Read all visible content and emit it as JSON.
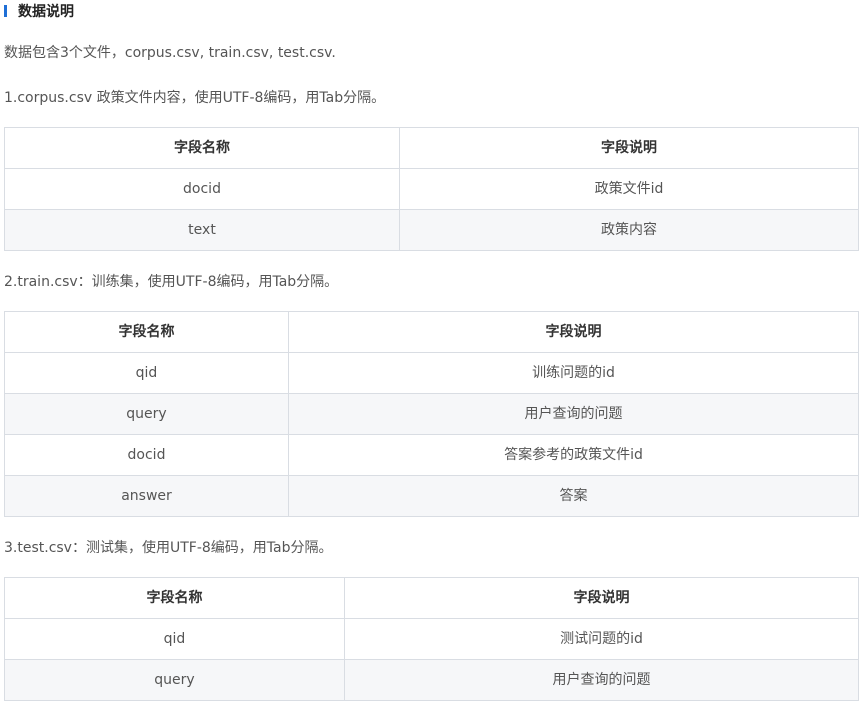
{
  "heading": "数据说明",
  "intro": "数据包含3个文件，corpus.csv, train.csv, test.csv.",
  "accent_color": "#1f6fd6",
  "sections": [
    {
      "desc": "1.corpus.csv 政策文件内容，使用UTF-8编码，用Tab分隔。",
      "headers": [
        "字段名称",
        "字段说明"
      ],
      "rows": [
        [
          "docid",
          "政策文件id"
        ],
        [
          "text",
          "政策内容"
        ]
      ]
    },
    {
      "desc": "2.train.csv：训练集，使用UTF-8编码，用Tab分隔。",
      "headers": [
        "字段名称",
        "字段说明"
      ],
      "rows": [
        [
          "qid",
          "训练问题的id"
        ],
        [
          "query",
          "用户查询的问题"
        ],
        [
          "docid",
          "答案参考的政策文件id"
        ],
        [
          "answer",
          "答案"
        ]
      ]
    },
    {
      "desc": "3.test.csv：测试集，使用UTF-8编码，用Tab分隔。",
      "headers": [
        "字段名称",
        "字段说明"
      ],
      "rows": [
        [
          "qid",
          "测试问题的id"
        ],
        [
          "query",
          "用户查询的问题"
        ]
      ]
    }
  ]
}
